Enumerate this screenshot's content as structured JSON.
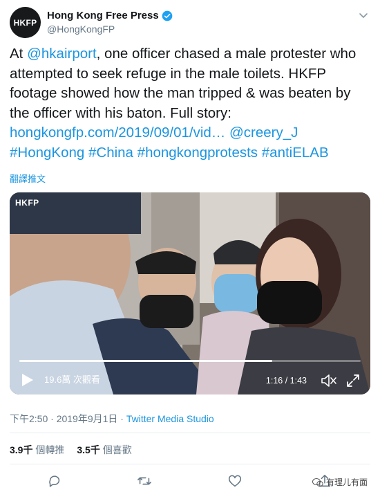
{
  "account": {
    "avatar_text": "HKFP",
    "display_name": "Hong Kong Free Press",
    "handle": "@HongKongFP"
  },
  "tweet": {
    "seg1": "At ",
    "mention1": "@hkairport",
    "seg2": ", one officer chased a male protester who attempted to seek refuge in the male toilets. HKFP footage showed how the man tripped & was beaten by the officer with his baton. Full story: ",
    "url": "hongkongfp.com/2019/09/01/vid…",
    "mention2": "@creery_J",
    "hashtags": [
      "#HongKong",
      "#China",
      "#hongkongprotests",
      "#antiELAB"
    ]
  },
  "translate_label": "翻譯推文",
  "video": {
    "watermark": "HKFP",
    "views": "19.6萬 次觀看",
    "time": "1:16 / 1:43",
    "progress": 0.74
  },
  "meta": {
    "timestamp": "下午2:50 · 2019年9月1日 · ",
    "source": "Twitter Media Studio"
  },
  "stats": {
    "retweets_count": "3.9千",
    "retweets_label": "個轉推",
    "likes_count": "3.5千",
    "likes_label": "個喜歡"
  },
  "watermark_text": "有理儿有面",
  "icons": {
    "verified": "verified-badge-icon",
    "caret": "chevron-down-icon",
    "play": "play-icon",
    "mute": "volume-muted-icon",
    "fullscreen": "fullscreen-icon",
    "reply": "reply-icon",
    "retweet": "retweet-icon",
    "like": "heart-icon",
    "share": "share-icon"
  },
  "colors": {
    "link": "#1b95e0",
    "text": "#14171a",
    "muted": "#657786",
    "verified": "#1da1f2"
  }
}
